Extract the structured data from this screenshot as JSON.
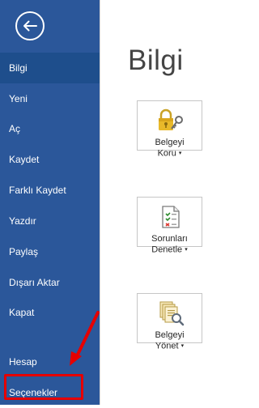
{
  "sidebar": {
    "background": "#2b579a",
    "items": [
      {
        "label": "Bilgi",
        "active": true
      },
      {
        "label": "Yeni"
      },
      {
        "label": "Aç"
      },
      {
        "label": "Kaydet"
      },
      {
        "label": "Farklı Kaydet"
      },
      {
        "label": "Yazdır"
      },
      {
        "label": "Paylaş"
      },
      {
        "label": "Dışarı Aktar"
      },
      {
        "label": "Kapat"
      },
      {
        "label": "Hesap"
      },
      {
        "label": "Seçenekler",
        "highlighted": true
      }
    ]
  },
  "main": {
    "title": "Bilgi",
    "tiles": [
      {
        "line1": "Belgeyi",
        "line2": "Koru",
        "icon": "lock-key-icon"
      },
      {
        "line1": "Sorunları",
        "line2": "Denetle",
        "icon": "inspect-document-icon"
      },
      {
        "line1": "Belgeyi",
        "line2": "Yönet",
        "icon": "manage-versions-icon"
      }
    ]
  },
  "annotation": {
    "color": "#e60000"
  }
}
